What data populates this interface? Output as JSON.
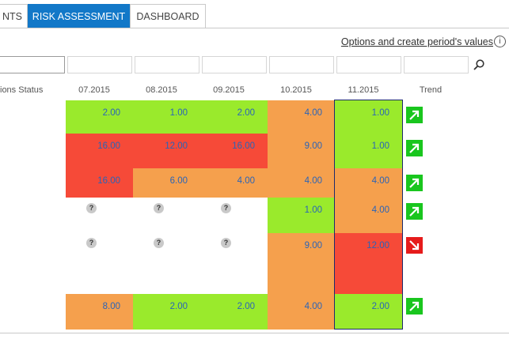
{
  "tabs": [
    {
      "label": "NTS",
      "active": false
    },
    {
      "label": "RISK ASSESSMENT",
      "active": true
    },
    {
      "label": "DASHBOARD",
      "active": false
    }
  ],
  "options_link": "Options and create period's values",
  "info_glyph": "i",
  "columns": {
    "status": "ions Status",
    "periods": [
      "07.2015",
      "08.2015",
      "09.2015",
      "10.2015",
      "11.2015"
    ],
    "trend": "Trend"
  },
  "selected_period": "11.2015",
  "question_mark": "?",
  "rows": [
    {
      "cells": [
        {
          "value": "2.00",
          "level": "green"
        },
        {
          "value": "1.00",
          "level": "green"
        },
        {
          "value": "2.00",
          "level": "green"
        },
        {
          "value": "4.00",
          "level": "orange"
        },
        {
          "value": "1.00",
          "level": "green"
        }
      ],
      "trend": "up"
    },
    {
      "cells": [
        {
          "value": "16.00",
          "level": "red"
        },
        {
          "value": "12.00",
          "level": "red"
        },
        {
          "value": "16.00",
          "level": "red"
        },
        {
          "value": "9.00",
          "level": "orange"
        },
        {
          "value": "1.00",
          "level": "green"
        }
      ],
      "trend": "up"
    },
    {
      "cells": [
        {
          "value": "16.00",
          "level": "red"
        },
        {
          "value": "6.00",
          "level": "orange"
        },
        {
          "value": "4.00",
          "level": "orange"
        },
        {
          "value": "4.00",
          "level": "orange"
        },
        {
          "value": "4.00",
          "level": "orange"
        }
      ],
      "trend": "up"
    },
    {
      "cells": [
        {
          "value": null,
          "level": "unknown"
        },
        {
          "value": null,
          "level": "unknown"
        },
        {
          "value": null,
          "level": "unknown"
        },
        {
          "value": "1.00",
          "level": "green"
        },
        {
          "value": "4.00",
          "level": "orange"
        }
      ],
      "trend": "up"
    },
    {
      "cells": [
        {
          "value": null,
          "level": "unknown"
        },
        {
          "value": null,
          "level": "unknown"
        },
        {
          "value": null,
          "level": "unknown"
        },
        {
          "value": "9.00",
          "level": "orange"
        },
        {
          "value": "12.00",
          "level": "red"
        }
      ],
      "trend": "down"
    },
    {
      "cells": [
        {
          "value": "8.00",
          "level": "orange"
        },
        {
          "value": "2.00",
          "level": "green"
        },
        {
          "value": "2.00",
          "level": "green"
        },
        {
          "value": "4.00",
          "level": "orange"
        },
        {
          "value": "2.00",
          "level": "green"
        }
      ],
      "trend": "up"
    }
  ],
  "colors": {
    "green": "#9aea2c",
    "orange": "#f5a04d",
    "red": "#f64a38",
    "tab_active": "#1278c8",
    "value_text": "#2a64b8",
    "trend_up": "#19c61e",
    "trend_down": "#e61b1b"
  },
  "icons": {
    "search": "search-icon",
    "info": "info-icon",
    "trend_up": "arrow-up-right-icon",
    "trend_down": "arrow-down-right-icon"
  }
}
